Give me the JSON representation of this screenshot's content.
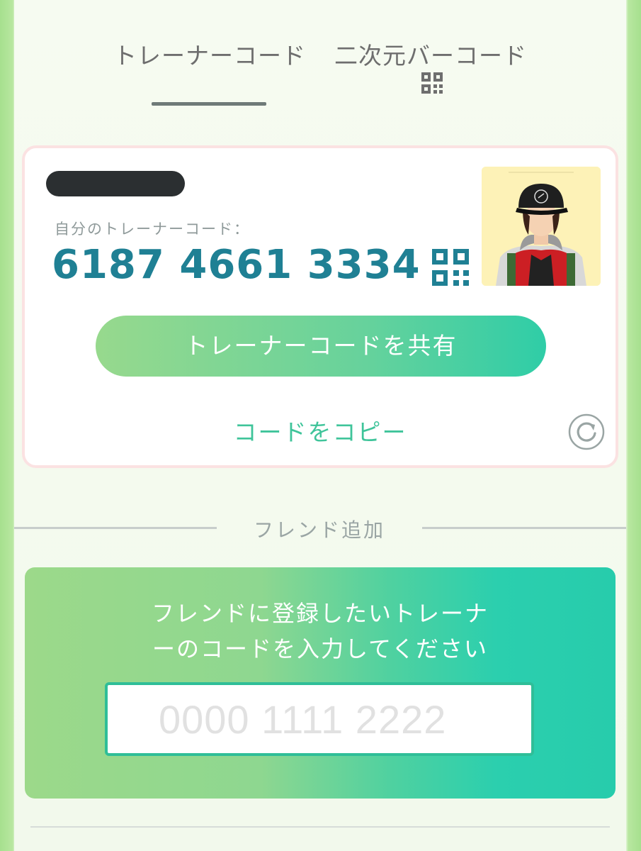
{
  "tabs": [
    {
      "label": "トレーナーコード",
      "active": true
    },
    {
      "label": "二次元バーコード",
      "active": false,
      "icon": "qr-code-icon"
    }
  ],
  "card": {
    "code_label": "自分のトレーナーコード：",
    "code_value": "6187 4661 3334",
    "share_button": "トレーナーコードを共有",
    "copy_link": "コードをコピー",
    "qr_icon": "qr-code-icon",
    "refresh_icon": "refresh-icon"
  },
  "add_friend": {
    "section_label": "フレンド追加",
    "prompt_line1": "フレンドに登録したいトレーナ",
    "prompt_line2": "ーのコードを入力してください",
    "input_placeholder": "0000 1111 2222",
    "input_value": ""
  },
  "colors": {
    "accent_teal": "#1f8094",
    "accent_green": "#3fc49a",
    "gradient_start": "#97d98d",
    "gradient_end": "#2bcfae"
  }
}
